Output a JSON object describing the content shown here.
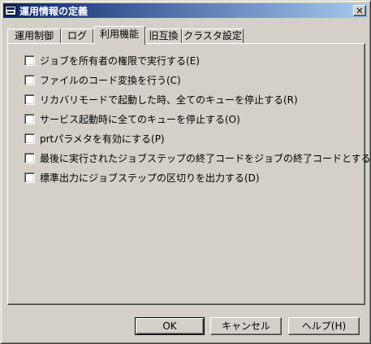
{
  "window": {
    "title": "運用情報の定義",
    "close_glyph": "✕"
  },
  "tabs": [
    {
      "label": "運用制御",
      "active": false
    },
    {
      "label": "ログ",
      "active": false
    },
    {
      "label": "利用機能",
      "active": true
    },
    {
      "label": "旧互換",
      "active": false
    },
    {
      "label": "クラスタ設定",
      "active": false
    }
  ],
  "options": [
    {
      "label": "ジョブを所有者の権限で実行する(E)",
      "checked": false
    },
    {
      "label": "ファイルのコード変換を行う(C)",
      "checked": false
    },
    {
      "label": "リカバリモードで起動した時、全てのキューを停止する(R)",
      "checked": false
    },
    {
      "label": "サービス起動時に全てのキューを停止する(O)",
      "checked": false
    },
    {
      "label": "prtパラメタを有効にする(P)",
      "checked": false
    },
    {
      "label": "最後に実行されたジョブステップの終了コードをジョブの終了コードとする(X)",
      "checked": false
    },
    {
      "label": "標準出力にジョブステップの区切りを出力する(D)",
      "checked": false
    }
  ],
  "buttons": {
    "ok": "OK",
    "cancel": "キャンセル",
    "help": "ヘルプ(H)"
  },
  "colors": {
    "face": "#d4d0c8",
    "title_start": "#0a246a",
    "title_end": "#a6caf0"
  }
}
